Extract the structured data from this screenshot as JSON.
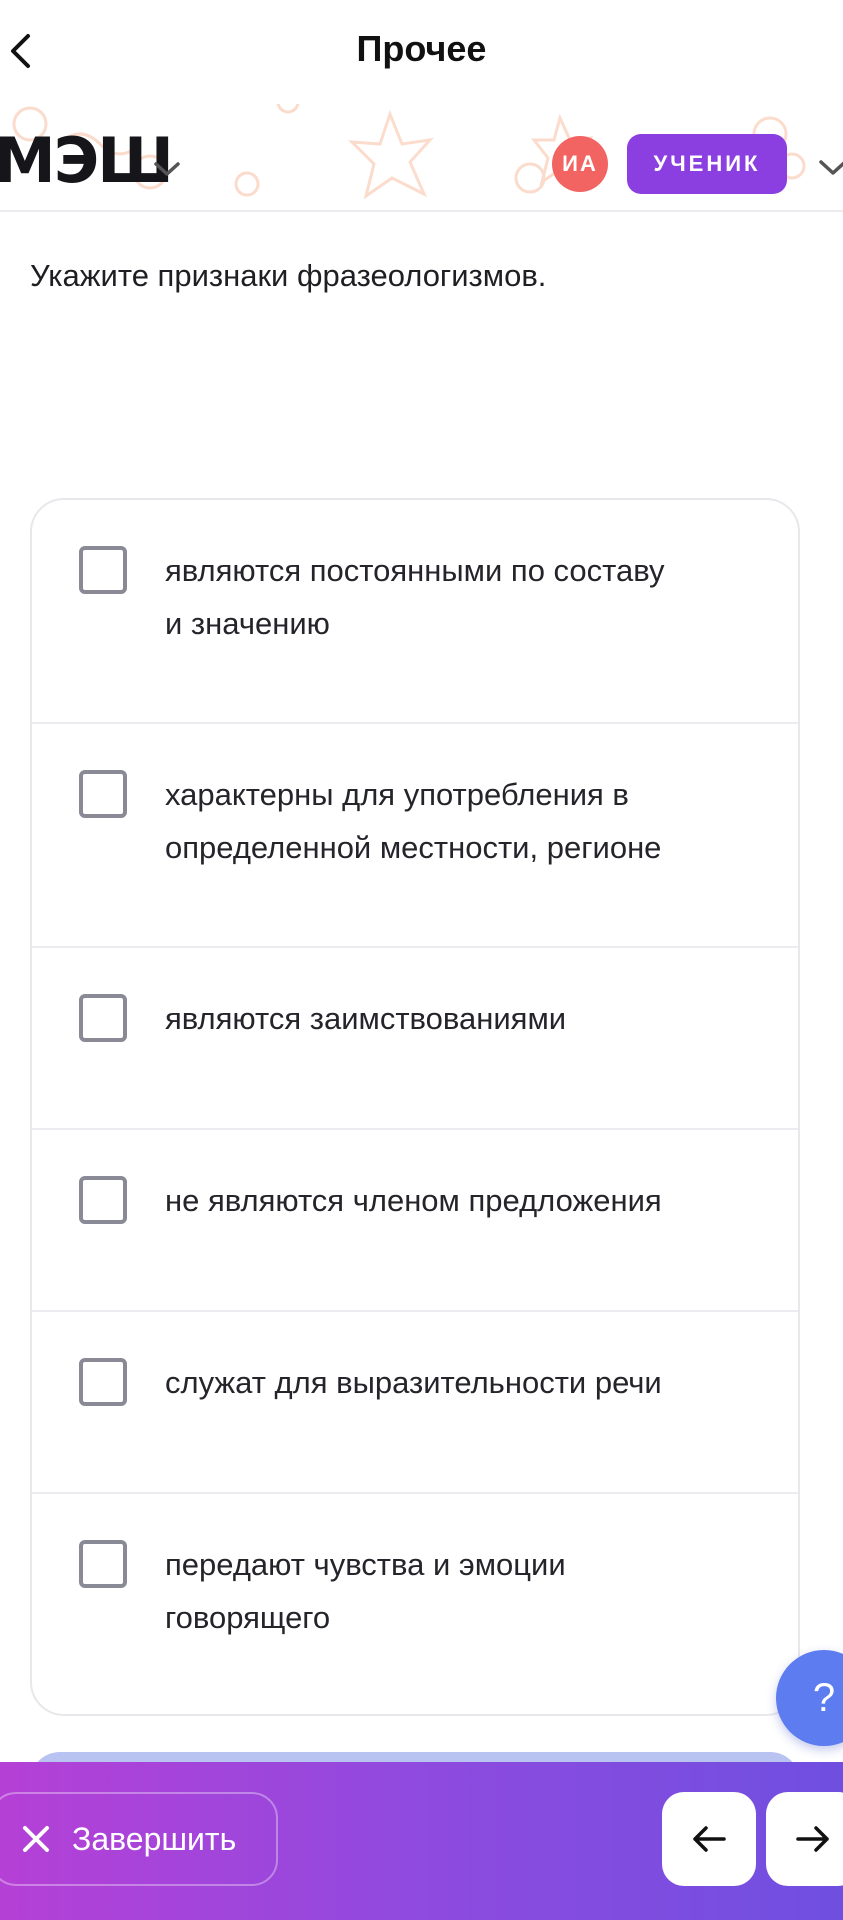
{
  "nav": {
    "title": "Прочее",
    "back_icon": "chevron-left-icon"
  },
  "app_header": {
    "logo": "МЭШ",
    "avatar_initials": "ИА",
    "role_badge": "УЧЕНИК",
    "colors": {
      "avatar": "#f26461",
      "badge": "#8b3fe0"
    }
  },
  "question": {
    "text": "Укажите признаки фразеологизмов."
  },
  "options": [
    {
      "lines": [
        "являются постоянными по составу",
        "и значению"
      ],
      "checked": false
    },
    {
      "lines": [
        "характерны для употребления в",
        "определенной местности, регионе"
      ],
      "checked": false
    },
    {
      "lines": [
        "являются заимствованиями"
      ],
      "checked": false
    },
    {
      "lines": [
        "не являются членом предложения"
      ],
      "checked": false
    },
    {
      "lines": [
        "служат для выразительности речи"
      ],
      "checked": false
    },
    {
      "lines": [
        "передают чувства и эмоции",
        "говорящего"
      ],
      "checked": false
    }
  ],
  "help": {
    "label": "?"
  },
  "bottom_bar": {
    "finish_label": "Завершить",
    "prev_icon": "arrow-left-icon",
    "next_icon": "arrow-right-icon",
    "gradient": [
      "#b540d6",
      "#6f4fe0"
    ]
  }
}
